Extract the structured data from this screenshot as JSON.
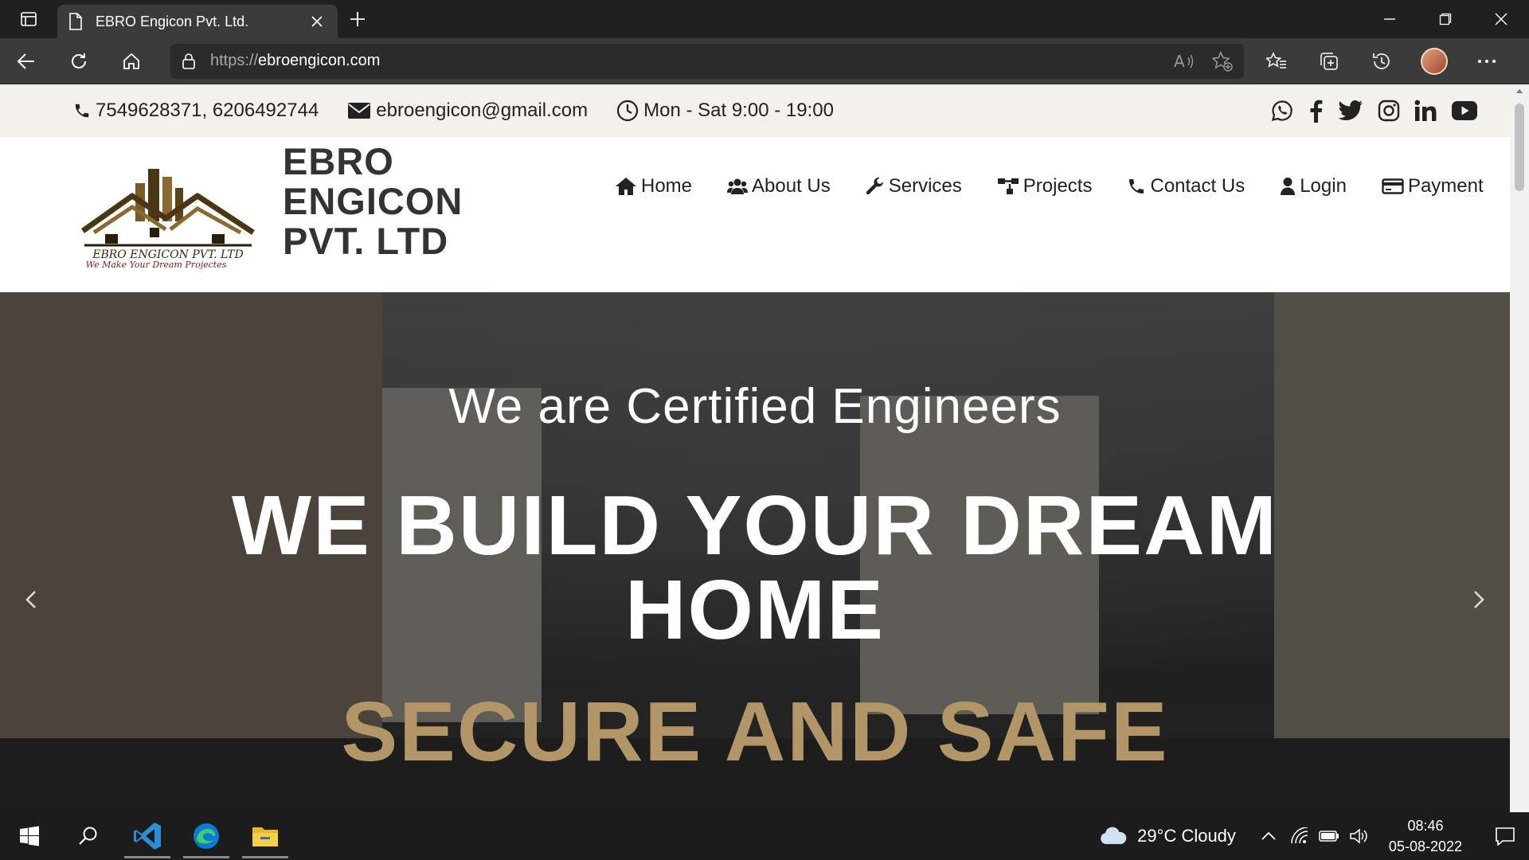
{
  "browser": {
    "tab_title": "EBRO Engicon Pvt. Ltd.",
    "url_protocol": "https://",
    "url_host": "ebroengicon.com"
  },
  "topbar": {
    "phone": "7549628371, 6206492744",
    "email": "ebroengicon@gmail.com",
    "hours": "Mon - Sat 9:00 - 19:00",
    "socials": [
      "whatsapp-icon",
      "facebook-icon",
      "twitter-icon",
      "instagram-icon",
      "linkedin-icon",
      "youtube-icon"
    ]
  },
  "header": {
    "brand_line1": "EBRO",
    "brand_line2": "ENGICON",
    "brand_line3": "PVT. LTD",
    "logo_text1": "EBRO ENGICON PVT. LTD",
    "logo_text2": "We Make Your Dream Projectes",
    "menu": [
      {
        "label": "Home",
        "icon": "home-icon"
      },
      {
        "label": "About Us",
        "icon": "users-icon"
      },
      {
        "label": "Services",
        "icon": "wrench-icon"
      },
      {
        "label": "Projects",
        "icon": "sitemap-icon"
      },
      {
        "label": "Contact Us",
        "icon": "phone-icon"
      },
      {
        "label": "Login",
        "icon": "user-icon"
      },
      {
        "label": "Payment",
        "icon": "card-icon"
      }
    ]
  },
  "hero": {
    "subtitle": "We are Certified Engineers",
    "title_line1": "WE BUILD YOUR DREAM",
    "title_line2": "HOME",
    "accent": "SECURE AND SAFE"
  },
  "taskbar": {
    "weather": "29°C  Cloudy",
    "time": "08:46",
    "date": "05-08-2022"
  },
  "colors": {
    "accent_gold": "#b29667",
    "topbar_bg": "#f3f1ec",
    "browser_dark": "#202020"
  }
}
